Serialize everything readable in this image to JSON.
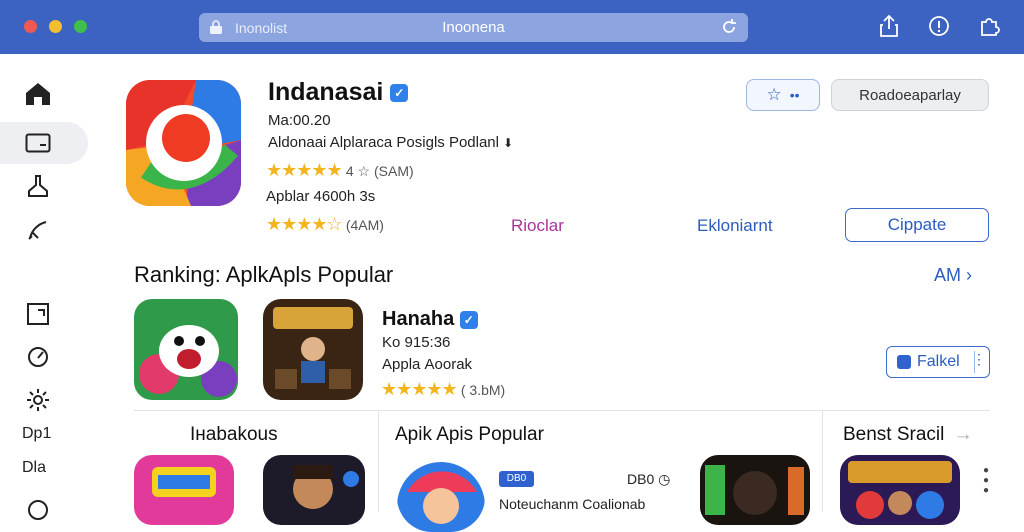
{
  "window": {
    "url_left": "Inonolist",
    "url_center": "Inoonena"
  },
  "sidebar": {
    "text_items": [
      "Dp1",
      "Dla"
    ]
  },
  "app": {
    "title": "Indanasai",
    "version": "Ma:00.20",
    "subtitle": "Aldonaai Alplaraca Posigls Podlanl",
    "rating1_stars": "★★★★★",
    "rating1_text": "4 ☆ (SAM)",
    "size_line": "Apblar 4600h 3s",
    "rating2_stars": "★★★★☆",
    "rating2_text": "(4AM)",
    "btn_gray_label": "Roadoeaparlay",
    "link_purple": "Rioclar",
    "link_blue": "Ekloniarnt",
    "btn_outline_label": "Cippate"
  },
  "ranking": {
    "title": "Ranking: AplkApls Popular",
    "see_all": "AM",
    "item": {
      "title": "Hanaha",
      "version": "Ko 915:36",
      "subtitle": "Applа Aoorak",
      "stars": "★★★★★",
      "rating_text": "( 3.bM)",
      "btn_label": "Falkel"
    }
  },
  "columns": {
    "left_title": "Iнabakous",
    "middle_title": "Apik Apis Popular",
    "right_title": "Benst Sracil",
    "mid_badge": "DB0",
    "mid_small": "DB0",
    "mid_desc": "Noteuchanm Coalionab"
  },
  "colors": {
    "titlebar": "#3d63c2",
    "accent": "#2c5cc0",
    "star": "#f2b51d"
  }
}
